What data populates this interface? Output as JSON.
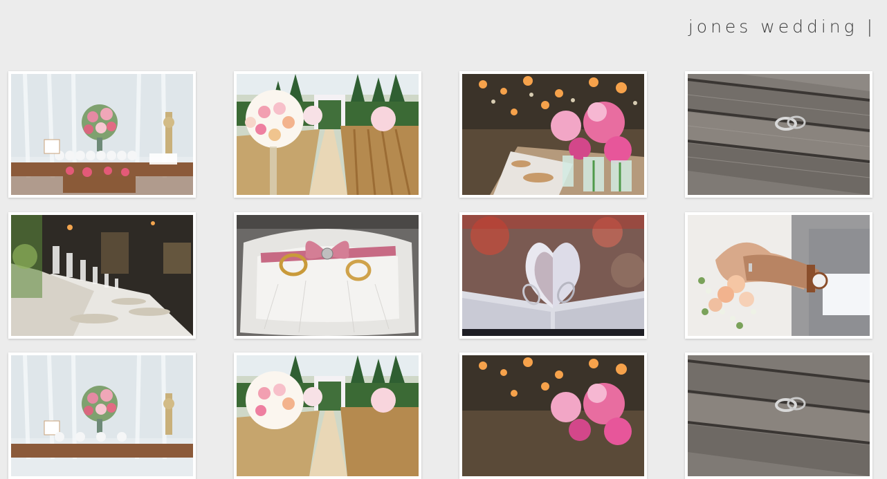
{
  "header": {
    "title": "jones wedding |"
  },
  "gallery": {
    "items": [
      {
        "id": 1,
        "subject": "dessert-table-with-flowers"
      },
      {
        "id": 2,
        "subject": "outdoor-aisle-with-floral-arch"
      },
      {
        "id": 3,
        "subject": "reception-table-pink-flowers-lights"
      },
      {
        "id": 4,
        "subject": "rings-on-wooden-boards"
      },
      {
        "id": 5,
        "subject": "long-banquet-table-wineglasses"
      },
      {
        "id": 6,
        "subject": "rings-on-pillow-pink-ribbon"
      },
      {
        "id": 7,
        "subject": "rings-in-book-heart-pages"
      },
      {
        "id": 8,
        "subject": "couple-hands-with-bouquet"
      },
      {
        "id": 9,
        "subject": "dessert-table-with-flowers"
      },
      {
        "id": 10,
        "subject": "outdoor-aisle-with-floral-arch"
      },
      {
        "id": 11,
        "subject": "reception-table-pink-flowers-lights"
      },
      {
        "id": 12,
        "subject": "rings-on-wooden-boards"
      }
    ]
  },
  "colors": {
    "background": "#ececec",
    "frame": "#ffffff",
    "title": "#3b3b3b"
  }
}
